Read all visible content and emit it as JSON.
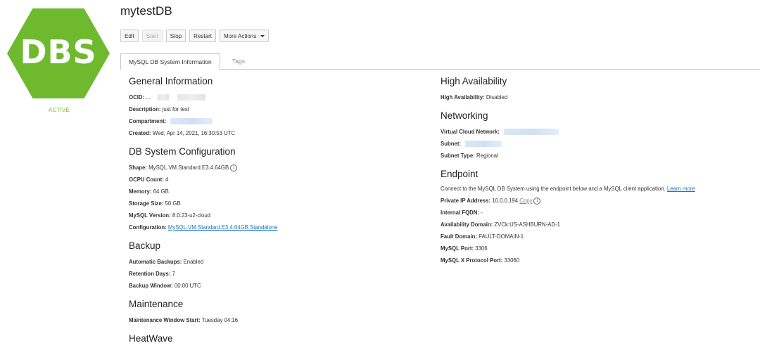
{
  "badge": {
    "text": "DBS",
    "status": "ACTIVE",
    "color": "#6fb92f"
  },
  "header": {
    "title": "mytestDB"
  },
  "actions": {
    "edit": "Edit",
    "start": "Start",
    "stop": "Stop",
    "restart": "Restart",
    "more": "More Actions"
  },
  "tabs": {
    "info": "MySQL DB System Information",
    "tags": "Tags"
  },
  "general": {
    "heading": "General Information",
    "ocid_label": "OCID:",
    "ocid_value": "...",
    "description_label": "Description:",
    "description_value": "just for test",
    "compartment_label": "Compartment:",
    "created_label": "Created:",
    "created_value": "Wed, Apr 14, 2021, 16:30:53 UTC"
  },
  "config": {
    "heading": "DB System Configuration",
    "shape_label": "Shape:",
    "shape_value": "MySQL.VM.Standard.E3.4.64GB",
    "ocpu_label": "OCPU Count:",
    "ocpu_value": "4",
    "memory_label": "Memory:",
    "memory_value": "64 GB",
    "storage_label": "Storage Size:",
    "storage_value": "50 GB",
    "version_label": "MySQL Version:",
    "version_value": "8.0.23-u2-cloud",
    "configuration_label": "Configuration:",
    "configuration_value": "MySQL.VM.Standard.E3.4.64GB.Standalone"
  },
  "backup": {
    "heading": "Backup",
    "auto_label": "Automatic Backups:",
    "auto_value": "Enabled",
    "retention_label": "Retention Days:",
    "retention_value": "7",
    "window_label": "Backup Window:",
    "window_value": "00:00 UTC"
  },
  "maintenance": {
    "heading": "Maintenance",
    "window_label": "Maintenance Window Start:",
    "window_value": "Tuesday 04:16"
  },
  "heatwave": {
    "heading": "HeatWave"
  },
  "ha": {
    "heading": "High Availability",
    "label": "High Availability:",
    "value": "Disabled"
  },
  "networking": {
    "heading": "Networking",
    "vcn_label": "Virtual Cloud Network:",
    "subnet_label": "Subnet:",
    "subnet_type_label": "Subnet Type:",
    "subnet_type_value": "Regional"
  },
  "endpoint": {
    "heading": "Endpoint",
    "description": "Connect to the MySQL DB System using the endpoint below and a MySQL client application.",
    "learn_more": "Learn more",
    "ip_label": "Private IP Address:",
    "ip_value": "10.0.0.194",
    "copy": "Copy",
    "fqdn_label": "Internal FQDN:",
    "fqdn_value": "-",
    "ad_label": "Availability Domain:",
    "ad_value": "ZVCk:US-ASHBURN-AD-1",
    "fd_label": "Fault Domain:",
    "fd_value": "FAULT-DOMAIN-1",
    "port_label": "MySQL Port:",
    "port_value": "3306",
    "xport_label": "MySQL X Protocol Port:",
    "xport_value": "33060"
  }
}
